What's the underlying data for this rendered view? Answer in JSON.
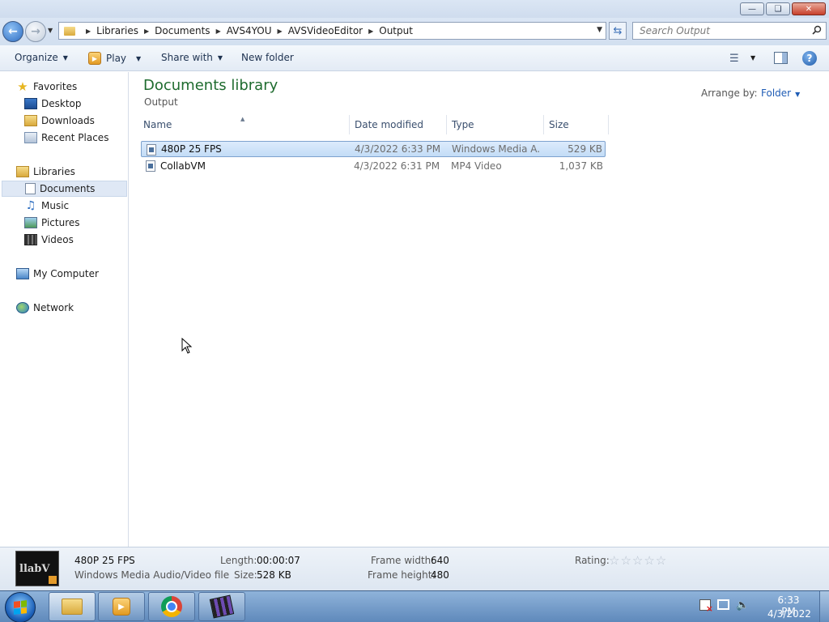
{
  "window": {
    "minimize_icon": "minimize-icon",
    "maximize_icon": "restore-icon",
    "close_icon": "close-icon"
  },
  "address": {
    "breadcrumbs": [
      "Libraries",
      "Documents",
      "AVS4YOU",
      "AVSVideoEditor",
      "Output"
    ]
  },
  "search": {
    "placeholder": "Search Output"
  },
  "toolbar": {
    "organize": "Organize",
    "play": "Play",
    "share_with": "Share with",
    "new_folder": "New folder"
  },
  "sidebar": {
    "favorites": "Favorites",
    "desktop": "Desktop",
    "downloads": "Downloads",
    "recent_places": "Recent Places",
    "libraries": "Libraries",
    "documents": "Documents",
    "music": "Music",
    "pictures": "Pictures",
    "videos": "Videos",
    "my_computer": "My Computer",
    "network": "Network"
  },
  "library": {
    "title": "Documents library",
    "subtitle": "Output",
    "arrange_label": "Arrange by:",
    "arrange_value": "Folder"
  },
  "columns": {
    "name": "Name",
    "date": "Date modified",
    "type": "Type",
    "size": "Size"
  },
  "files": [
    {
      "name": "480P 25 FPS",
      "date": "4/3/2022 6:33 PM",
      "type": "Windows Media A...",
      "size": "529 KB",
      "selected": true
    },
    {
      "name": "CollabVM",
      "date": "4/3/2022 6:31 PM",
      "type": "MP4 Video",
      "size": "1,037 KB",
      "selected": false
    }
  ],
  "details": {
    "thumb_text": "llabV",
    "name": "480P 25 FPS",
    "type": "Windows Media Audio/Video file",
    "length_label": "Length:",
    "length_value": "00:00:07",
    "size_label": "Size:",
    "size_value": "528 KB",
    "frame_width_label": "Frame width:",
    "frame_width_value": "640",
    "frame_height_label": "Frame height:",
    "frame_height_value": "480",
    "rating_label": "Rating:",
    "rating_stars": "☆☆☆☆☆"
  },
  "taskbar": {
    "time": "6:33 PM",
    "date": "4/3/2022"
  }
}
